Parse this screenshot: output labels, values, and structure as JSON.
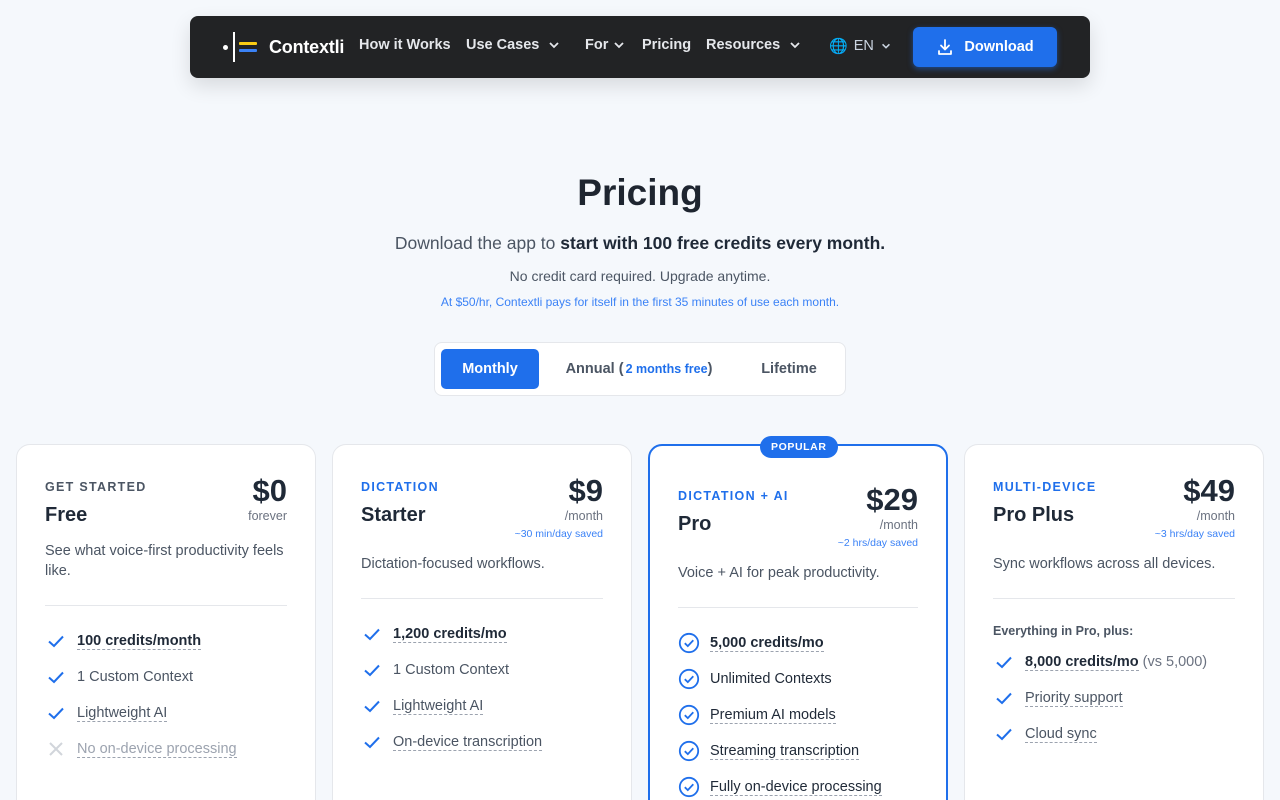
{
  "nav": {
    "brand": "Contextli",
    "items": [
      {
        "label": "How it Works"
      },
      {
        "label": "Use Cases"
      },
      {
        "label": "For"
      },
      {
        "label": "Pricing"
      },
      {
        "label": "Resources"
      }
    ],
    "language": "EN",
    "download_label": "Download"
  },
  "hero": {
    "title": "Pricing",
    "subtitle_prefix": "Download the app to",
    "subtitle_bold": "start with 100 free credits every month.",
    "note": "No credit card required. Upgrade anytime.",
    "roi": "At $50/hr, Contextli pays for itself in the first 35 minutes of use each month."
  },
  "billing_toggle": {
    "monthly": "Monthly",
    "annual": "Annual",
    "annual_open": "(",
    "annual_free": "2 months free",
    "annual_close": ")",
    "lifetime": "Lifetime",
    "selected": "Monthly"
  },
  "plans": [
    {
      "tier": "GET STARTED",
      "name": "Free",
      "price": "$0",
      "period": "forever",
      "description": "See what voice-first productivity feels like.",
      "features": [
        {
          "text": "100 credits/month",
          "included": true
        },
        {
          "text": "1 Custom Context",
          "included": true
        },
        {
          "text": "Lightweight AI",
          "included": true
        },
        {
          "text": "No on-device processing",
          "included": false
        }
      ]
    },
    {
      "tier": "DICTATION",
      "name": "Starter",
      "price": "$9",
      "period": "/month",
      "saved": "~30 min/day saved",
      "description": "Dictation-focused workflows.",
      "features": [
        {
          "text": "1,200 credits/mo",
          "included": true
        },
        {
          "text": "1 Custom Context",
          "included": true
        },
        {
          "text": "Lightweight AI",
          "included": true
        },
        {
          "text": "On-device transcription",
          "included": true
        }
      ]
    },
    {
      "badge": "POPULAR",
      "tier": "DICTATION + AI",
      "name": "Pro",
      "price": "$29",
      "period": "/month",
      "saved": "~2 hrs/day saved",
      "description": "Voice + AI for peak productivity.",
      "features": [
        {
          "text": "5,000 credits/mo",
          "included": true
        },
        {
          "text": "Unlimited Contexts",
          "included": true
        },
        {
          "text": "Premium AI models",
          "included": true
        },
        {
          "text": "Streaming transcription",
          "included": true
        },
        {
          "text": "Fully on-device processing",
          "included": true
        }
      ]
    },
    {
      "tier": "MULTI-DEVICE",
      "name": "Pro Plus",
      "price": "$49",
      "period": "/month",
      "saved": "~3 hrs/day saved",
      "description": "Sync workflows across all devices.",
      "everything_label": "Everything in Pro, plus:",
      "features": [
        {
          "text": "8,000 credits/mo",
          "extra": "(vs 5,000)",
          "included": true
        },
        {
          "text": "Priority support",
          "included": true
        },
        {
          "text": "Cloud sync",
          "included": true
        }
      ]
    }
  ],
  "colors": {
    "accent": "#1f6feb",
    "nav_bg": "#222325",
    "page_bg": "#f5f8fc",
    "logo_yellow": "#facc15",
    "logo_blue": "#3b82f6"
  },
  "icons": {
    "chevron": "chevron-down-icon",
    "globe": "globe-icon",
    "download": "download-icon",
    "check": "check-icon",
    "check_circle": "check-circle-icon",
    "x": "x-icon"
  }
}
